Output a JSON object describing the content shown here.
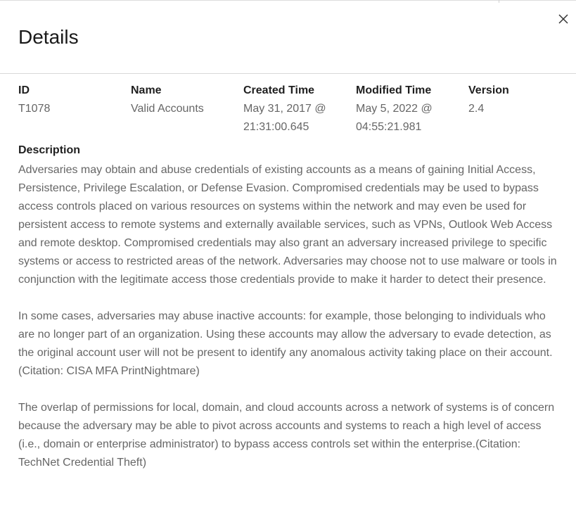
{
  "header": {
    "title": "Details",
    "close_icon": "close-icon"
  },
  "meta": {
    "id": {
      "label": "ID",
      "value": "T1078"
    },
    "name": {
      "label": "Name",
      "value": "Valid Accounts"
    },
    "created": {
      "label": "Created Time",
      "value": "May 31, 2017 @\n21:31:00.645"
    },
    "modified": {
      "label": "Modified Time",
      "value": "May 5, 2022 @\n04:55:21.981"
    },
    "version": {
      "label": "Version",
      "value": "2.4"
    }
  },
  "description": {
    "label": "Description",
    "paragraphs": [
      "Adversaries may obtain and abuse credentials of existing accounts as a means of gaining Initial Access, Persistence, Privilege Escalation, or Defense Evasion. Compromised credentials may be used to bypass access controls placed on various resources on systems within the network and may even be used for persistent access to remote systems and externally available services, such as VPNs, Outlook Web Access and remote desktop. Compromised credentials may also grant an adversary increased privilege to specific systems or access to restricted areas of the network. Adversaries may choose not to use malware or tools in conjunction with the legitimate access those credentials provide to make it harder to detect their presence.",
      "In some cases, adversaries may abuse inactive accounts: for example, those belonging to individuals who are no longer part of an organization. Using these accounts may allow the adversary to evade detection, as the original account user will not be present to identify any anomalous activity taking place on their account.(Citation: CISA MFA PrintNightmare)",
      "The overlap of permissions for local, domain, and cloud accounts across a network of systems is of concern because the adversary may be able to pivot across accounts and systems to reach a high level of access (i.e., domain or enterprise administrator) to bypass access controls set within the enterprise.(Citation: TechNet Credential Theft)"
    ]
  }
}
